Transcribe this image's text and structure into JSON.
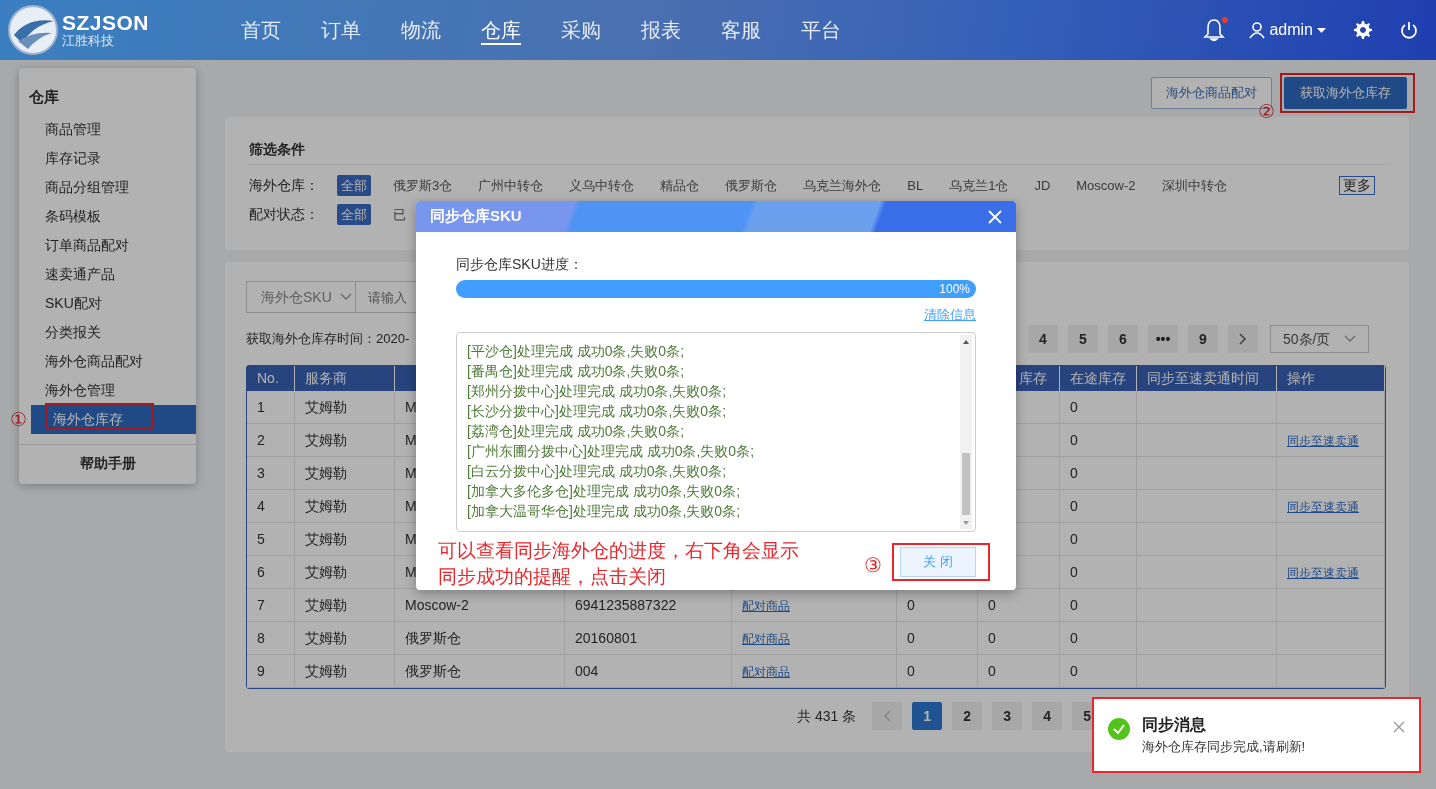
{
  "navbar": {
    "logo_title": "SZJSON",
    "logo_subtitle": "江胜科技",
    "user": "admin",
    "notification_unread": true,
    "menu": [
      {
        "label": "首页",
        "selected": false
      },
      {
        "label": "订单",
        "selected": false
      },
      {
        "label": "物流",
        "selected": false
      },
      {
        "label": "仓库",
        "selected": true
      },
      {
        "label": "采购",
        "selected": false
      },
      {
        "label": "报表",
        "selected": false
      },
      {
        "label": "客服",
        "selected": false
      },
      {
        "label": "平台",
        "selected": false
      }
    ]
  },
  "sidebar": {
    "title": "仓库",
    "help": "帮助手册",
    "annotation": "①",
    "items": [
      {
        "label": "商品管理",
        "selected": false
      },
      {
        "label": "库存记录",
        "selected": false
      },
      {
        "label": "商品分组管理",
        "selected": false
      },
      {
        "label": "条码模板",
        "selected": false
      },
      {
        "label": "订单商品配对",
        "selected": false
      },
      {
        "label": "速卖通产品",
        "selected": false
      },
      {
        "label": "SKU配对",
        "selected": false
      },
      {
        "label": "分类报关",
        "selected": false
      },
      {
        "label": "海外仓商品配对",
        "selected": false
      },
      {
        "label": "海外仓管理",
        "selected": false
      },
      {
        "label": "海外仓库存",
        "selected": true
      }
    ]
  },
  "actions": [
    {
      "label": "海外仓商品配对",
      "kind": "outline"
    },
    {
      "label": "获取海外仓库存",
      "kind": "primary",
      "annotation": "②"
    }
  ],
  "filter": {
    "title": "筛选条件",
    "more": "更多",
    "rows": [
      {
        "label": "海外仓库：",
        "options": [
          {
            "label": "全部",
            "selected": true
          },
          {
            "label": "俄罗斯3仓",
            "selected": false
          },
          {
            "label": "广州中转仓",
            "selected": false
          },
          {
            "label": "义乌中转仓",
            "selected": false
          },
          {
            "label": "精品仓",
            "selected": false
          },
          {
            "label": "俄罗斯仓",
            "selected": false
          },
          {
            "label": "乌克兰海外仓",
            "selected": false
          },
          {
            "label": "BL",
            "selected": false
          },
          {
            "label": "乌克兰1仓",
            "selected": false
          },
          {
            "label": "JD",
            "selected": false
          },
          {
            "label": "Moscow-2",
            "selected": false
          },
          {
            "label": "深圳中转仓",
            "selected": false
          }
        ]
      },
      {
        "label": "配对状态：",
        "options": [
          {
            "label": "全部",
            "selected": true
          },
          {
            "label": "已",
            "selected": false
          }
        ]
      }
    ]
  },
  "toolbar": {
    "select": "海外仓SKU",
    "search_placeholder": "请输入",
    "fetch_time": "获取海外仓库存时间：2020-"
  },
  "pager_top": {
    "pages": [
      {
        "label": "4",
        "selected": false
      },
      {
        "label": "5",
        "selected": false
      },
      {
        "label": "6",
        "selected": false
      },
      {
        "label": "•••",
        "selected": false
      },
      {
        "label": "9",
        "selected": false
      }
    ],
    "page_size": "50条/页"
  },
  "table": {
    "columns": [
      "No.",
      "服务商",
      null,
      null,
      null,
      null,
      "库存",
      "在途库存",
      "同步至速卖通时间",
      "操作"
    ],
    "rows": [
      [
        "1",
        "艾姆勒",
        "M",
        null,
        null,
        null,
        null,
        "0",
        null,
        null
      ],
      [
        "2",
        "艾姆勒",
        "M",
        null,
        null,
        null,
        null,
        "0",
        null,
        "同步至速卖通"
      ],
      [
        "3",
        "艾姆勒",
        "M",
        null,
        null,
        null,
        null,
        "0",
        null,
        null
      ],
      [
        "4",
        "艾姆勒",
        "M",
        null,
        null,
        null,
        null,
        "0",
        null,
        "同步至速卖通"
      ],
      [
        "5",
        "艾姆勒",
        "M",
        null,
        null,
        null,
        null,
        "0",
        null,
        null
      ],
      [
        "6",
        "艾姆勒",
        "M",
        null,
        null,
        null,
        null,
        "0",
        null,
        "同步至速卖通"
      ],
      [
        "7",
        "艾姆勒",
        "Moscow-2",
        "6941235887322",
        "配对商品",
        "0",
        "0",
        "0",
        null,
        null
      ],
      [
        "8",
        "艾姆勒",
        "俄罗斯仓",
        "20160801",
        "配对商品",
        "0",
        "0",
        "0",
        null,
        null
      ],
      [
        "9",
        "艾姆勒",
        "俄罗斯仓",
        "004",
        "配对商品",
        "0",
        "0",
        "0",
        null,
        null
      ]
    ]
  },
  "pager_bottom": {
    "total": "共 431 条",
    "pages": [
      {
        "label": "1",
        "selected": true
      },
      {
        "label": "2",
        "selected": false
      },
      {
        "label": "3",
        "selected": false
      },
      {
        "label": "4",
        "selected": false
      },
      {
        "label": "5",
        "selected": false
      }
    ]
  },
  "dialog": {
    "title": "同步仓库SKU",
    "progress_label": "同步仓库SKU进度：",
    "level": 1,
    "reading": "100%",
    "clear": "清除信息",
    "log": [
      "[平沙仓]处理完成 成功0条,失败0条;",
      "[番禺仓]处理完成 成功0条,失败0条;",
      "[郑州分拨中心]处理完成 成功0条,失败0条;",
      "[长沙分拨中心]处理完成 成功0条,失败0条;",
      "[荔湾仓]处理完成 成功0条,失败0条;",
      "[广州东圃分拨中心]处理完成 成功0条,失败0条;",
      "[白云分拨中心]处理完成 成功0条,失败0条;",
      "[加拿大多伦多仓]处理完成 成功0条,失败0条;",
      "[加拿大温哥华仓]处理完成 成功0条,失败0条;"
    ],
    "note_lines": [
      "可以查看同步海外仓的进度，右下角会显示",
      "同步成功的提醒，点击关闭"
    ],
    "close_button": "关 闭",
    "annotation": "③"
  },
  "toast": {
    "title": "同步消息",
    "message": "海外仓库存同步完成,请刷新!"
  }
}
